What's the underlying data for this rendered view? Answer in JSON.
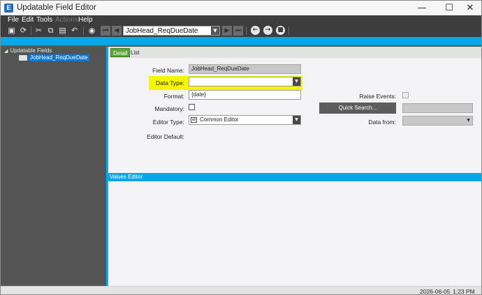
{
  "window": {
    "title": "Updatable Field Editor",
    "app_icon_letter": "E",
    "minimize_glyph": "—",
    "maximize_glyph": "☐",
    "close_glyph": "✕"
  },
  "menu": {
    "items": [
      "File",
      "Edit",
      "Tools",
      "Actions",
      "Help"
    ]
  },
  "toolbar": {
    "record_value": "JobHead_ReqDueDate",
    "icons": [
      "save-icon",
      "refresh-icon",
      "cut-icon",
      "copy-icon",
      "paste-icon",
      "undo-icon",
      "binoculars-icon",
      "first-record-icon",
      "previous-record-icon",
      "next-record-icon",
      "last-record-icon",
      "back-icon",
      "forward-icon",
      "stop-icon"
    ]
  },
  "tree": {
    "root_label": "Updatable Fields",
    "child_label": "JobHead_ReqDueDate"
  },
  "tabs": {
    "detail": "Detail",
    "list": "List"
  },
  "detail": {
    "field_name_label": "Field Name:",
    "field_name_value": "JobHead_ReqDueDate",
    "data_type_label": "Data Type:",
    "data_type_value": "",
    "format_label": "Format:",
    "format_value": "{date}",
    "mandatory_label": "Mandatory:",
    "mandatory_checked": false,
    "editor_type_label": "Editor Type:",
    "editor_type_value": "Common Editor",
    "editor_default_label": "Editor Default:",
    "raise_events_label": "Raise Events:",
    "quick_search_button": "Quick Search...",
    "quick_search_value": "",
    "data_from_label": "Data from:",
    "data_from_value": "",
    "highlight_color": "#f6f600"
  },
  "values_editor": {
    "title": "Values Editor"
  },
  "status": {
    "date": "2026-06-05",
    "time": "1:23 PM"
  },
  "colors": {
    "accent_blue": "#06a7e6",
    "toolbar_dark": "#3d3d3d",
    "tab_active_green": "#5ca53a",
    "tree_selection": "#0a78d0"
  }
}
